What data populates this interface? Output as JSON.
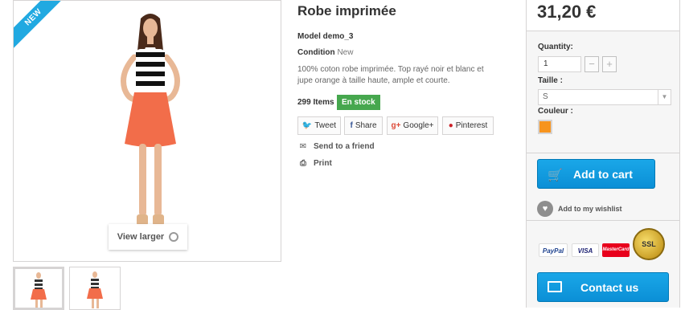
{
  "product": {
    "badge": "NEW",
    "view_larger_label": "View larger",
    "title": "Robe imprimée",
    "model_label": "Model",
    "model_value": "demo_3",
    "condition_label": "Condition",
    "condition_value": "New",
    "description": "100% coton robe imprimée. Top rayé noir et blanc et jupe orange à taille haute, ample et courte.",
    "quantity_text": "299 Items",
    "stock_status": "En stock"
  },
  "share": {
    "tweet": "Tweet",
    "share": "Share",
    "google": "Google+",
    "pinterest": "Pinterest"
  },
  "actions": {
    "send_friend": "Send to a friend",
    "print": "Print"
  },
  "buy_box": {
    "price": "31,20 €",
    "quantity_label": "Quantity:",
    "quantity_value": "1",
    "minus": "−",
    "plus": "+",
    "size_label": "Taille :",
    "size_value": "S",
    "color_label": "Couleur :",
    "color_hex": "#f7941d",
    "add_to_cart": "Add to cart",
    "wishlist": "Add to my wishlist",
    "contact": "Contact us"
  },
  "payment": {
    "paypal": "PayPal",
    "visa": "VISA",
    "mastercard": "MasterCard",
    "ssl": "SSL"
  },
  "colors": {
    "accent_blue": "#0b8fd6",
    "badge_blue": "#21a9e1",
    "stock_green": "#46a74e"
  }
}
